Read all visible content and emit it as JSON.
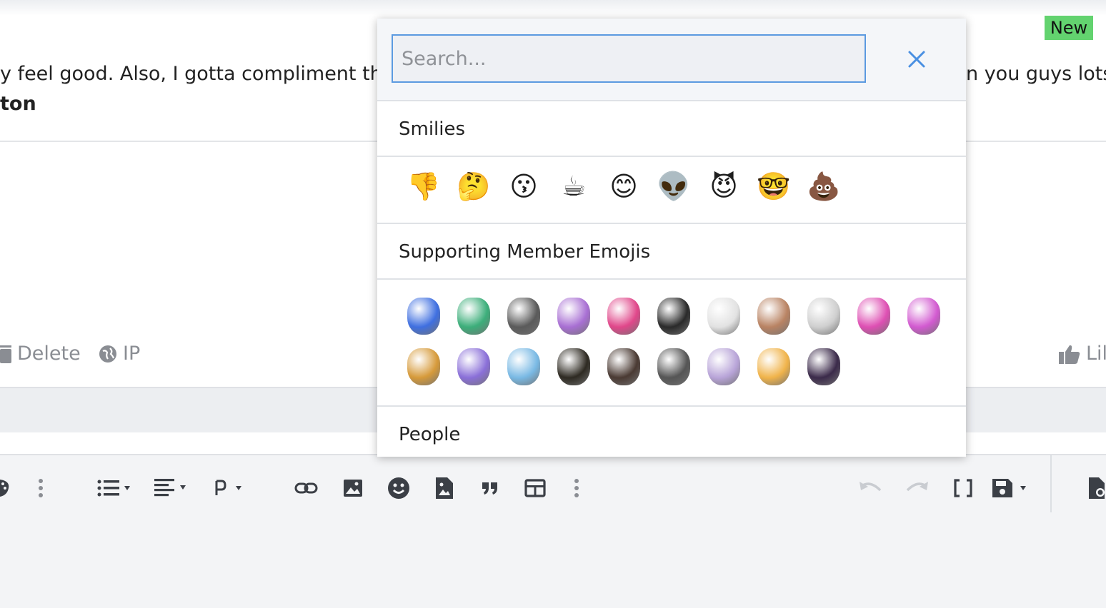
{
  "badge": {
    "new": "New"
  },
  "post": {
    "line1_left": "y feel good. Also, I gotta compliment th",
    "line1_right": "n you guys lots",
    "line2": "ton"
  },
  "actions": {
    "delete": "Delete",
    "ip": "IP",
    "like": "Lil"
  },
  "picker": {
    "search_placeholder": "Search...",
    "categories": [
      {
        "title": "Smilies"
      },
      {
        "title": "Supporting Member Emojis"
      },
      {
        "title": "People"
      }
    ],
    "smilies": [
      {
        "glyph": "👎",
        "icon": "thumbs-down-icon"
      },
      {
        "glyph": "🤔",
        "icon": "thinking-face-icon"
      },
      {
        "glyph": "😗",
        "icon": "kissing-face-icon"
      },
      {
        "glyph": "☕",
        "icon": "coffee-icon"
      },
      {
        "glyph": "😊",
        "icon": "smiling-face-icon"
      },
      {
        "glyph": "👽",
        "icon": "alien-icon"
      },
      {
        "glyph": "😈",
        "icon": "devil-face-icon"
      },
      {
        "glyph": "🤓",
        "icon": "nerd-face-icon"
      },
      {
        "glyph": "💩",
        "icon": "poop-icon"
      }
    ],
    "member_emojis": [
      {
        "icon": "blue-heart-anatomical-icon",
        "color": "#3f6fe0"
      },
      {
        "icon": "green-skull-icon",
        "color": "#3cae7a"
      },
      {
        "icon": "guitar-pick-skull-icon",
        "color": "#5a5a5a"
      },
      {
        "icon": "rainbow-heart-face-icon",
        "color": "#a86fd3"
      },
      {
        "icon": "lightning-pick-icon",
        "color": "#e0478a"
      },
      {
        "icon": "black-alien-face-icon",
        "color": "#2a2a2a"
      },
      {
        "icon": "white-mushroom-icon",
        "color": "#e2e2e2"
      },
      {
        "icon": "man-face-icon",
        "color": "#b98363"
      },
      {
        "icon": "man-face-bw-icon",
        "color": "#cfcfcf"
      },
      {
        "icon": "pink-heart-anatomical-icon",
        "color": "#de4fb3"
      },
      {
        "icon": "pink-skull-icon",
        "color": "#d25ad0"
      },
      {
        "icon": "psychedelic-mushroom-icon",
        "color": "#d69a3a"
      },
      {
        "icon": "holographic-skull-icon",
        "color": "#8a6fd8"
      },
      {
        "icon": "rock-hand-icon",
        "color": "#79b9e4"
      },
      {
        "icon": "gold-black-skull-icon",
        "color": "#2e2a22"
      },
      {
        "icon": "spiky-hair-man-icon",
        "color": "#4a3a33"
      },
      {
        "icon": "spiky-hair-man-bw-icon",
        "color": "#555555"
      },
      {
        "icon": "anarchy-symbol-icon",
        "color": "#b8a4d8"
      },
      {
        "icon": "orange-skull-icon",
        "color": "#f0b34a"
      },
      {
        "icon": "bass-guitar-icon",
        "color": "#3b2a4a"
      }
    ]
  }
}
